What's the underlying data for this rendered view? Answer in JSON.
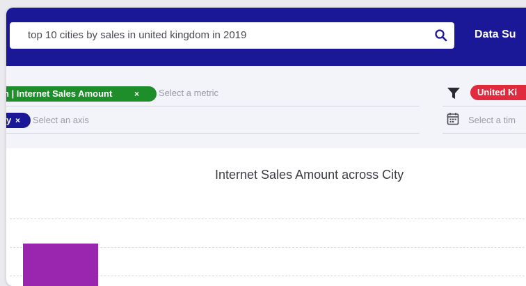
{
  "search": {
    "query": "top 10 cities by sales in united kingdom in 2019",
    "icon": "search-icon"
  },
  "header": {
    "title": "Data Su"
  },
  "metric": {
    "chip_label": "n | Internet Sales Amount",
    "close": "×",
    "placeholder": "Select a metric"
  },
  "axis": {
    "chip_label": "y",
    "close": "×",
    "placeholder": "Select an axis"
  },
  "filter": {
    "icon": "filter-icon",
    "chip_label": "United Ki"
  },
  "time": {
    "icon": "calendar-icon",
    "placeholder": "Select a tim"
  },
  "colors": {
    "header": "#1a1896",
    "metric_chip": "#1e8e2b",
    "axis_chip": "#1a1896",
    "filter_chip": "#df2b3d",
    "bar": "#9a26b0"
  },
  "chart_data": {
    "type": "bar",
    "title": "Internet Sales Amount across City",
    "xlabel": "",
    "ylabel": "",
    "grid": true,
    "categories": [
      ""
    ],
    "values": [
      null
    ],
    "legend": "none"
  }
}
